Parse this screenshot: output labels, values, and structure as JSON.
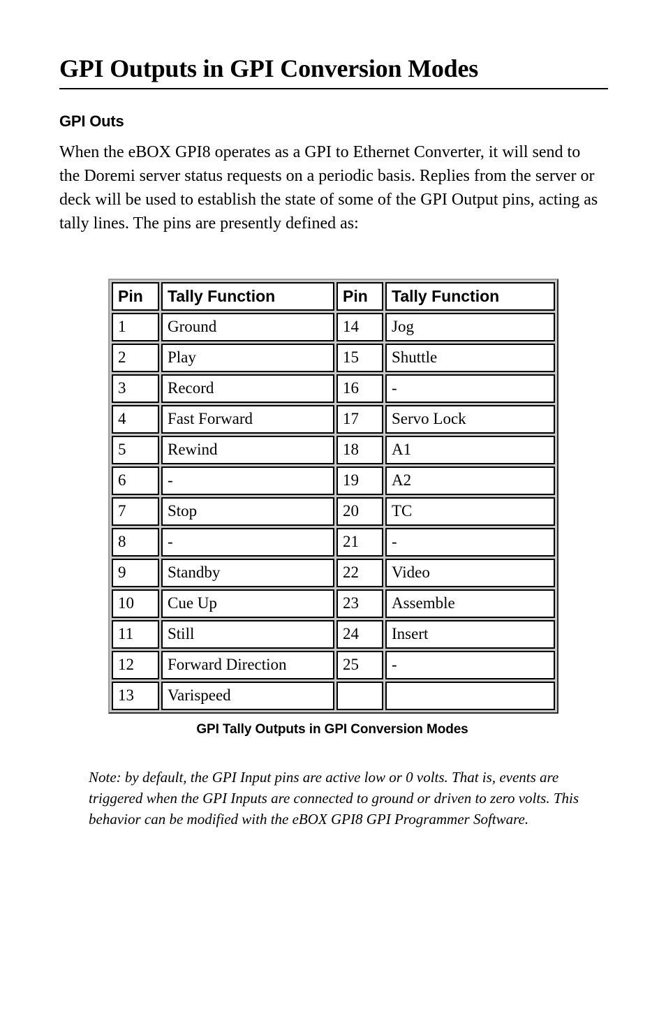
{
  "document": {
    "title": "GPI Outputs in GPI Conversion Modes",
    "section_heading": "GPI Outs",
    "intro_paragraph": "When the eBOX GPI8 operates as a GPI to Ethernet Converter, it will send to the Doremi server status requests on a periodic basis.  Replies from the server or deck will be used to establish the state of some of the GPI Output pins, acting as tally lines.  The pins are presently defined as:",
    "table_caption": "GPI Tally Outputs in GPI Conversion Modes",
    "note": "Note:  by default, the GPI Input pins are active low or 0 volts.  That is, events are triggered when the GPI Inputs are connected to ground or driven to zero volts.  This behavior can be modified with the eBOX GPI8 GPI Programmer Software."
  },
  "pin_table": {
    "headers": [
      "Pin",
      "Tally Function",
      "Pin",
      "Tally Function"
    ],
    "rows": [
      [
        "1",
        "Ground",
        "14",
        "Jog"
      ],
      [
        "2",
        "Play",
        "15",
        "Shuttle"
      ],
      [
        "3",
        "Record",
        "16",
        "-"
      ],
      [
        "4",
        "Fast Forward",
        "17",
        "Servo Lock"
      ],
      [
        "5",
        "Rewind",
        "18",
        "A1"
      ],
      [
        "6",
        "-",
        "19",
        "A2"
      ],
      [
        "7",
        "Stop",
        "20",
        "TC"
      ],
      [
        "8",
        "-",
        "21",
        "-"
      ],
      [
        "9",
        "Standby",
        "22",
        "Video"
      ],
      [
        "10",
        "Cue Up",
        "23",
        "Assemble"
      ],
      [
        "11",
        "Still",
        "24",
        "Insert"
      ],
      [
        "12",
        "Forward Direction",
        "25",
        "-"
      ],
      [
        "13",
        "Varispeed",
        "",
        ""
      ]
    ]
  },
  "colors": {
    "text": "#000000",
    "page_background": "#ffffff",
    "table_gap": "#c8c8c8",
    "table_border_light": "#9a9a9a",
    "table_border_dark": "#2b2b2b",
    "cell_border": "#000000"
  }
}
